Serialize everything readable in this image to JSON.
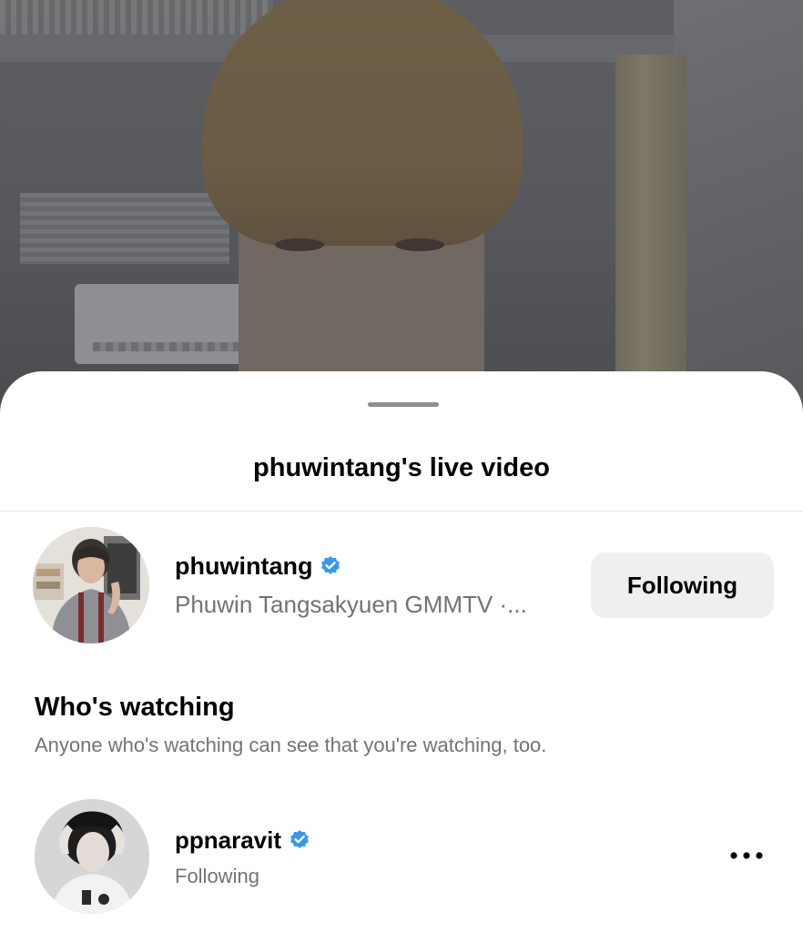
{
  "video": {
    "streamer": "phuwintang"
  },
  "sheet": {
    "title": "phuwintang's live video"
  },
  "host": {
    "username": "phuwintang",
    "subtitle": "Phuwin Tangsakyuen GMMTV ·...",
    "verified": true,
    "follow_button_label": "Following"
  },
  "watching": {
    "title": "Who's watching",
    "subtitle": "Anyone who's watching can see that you're watching, too.",
    "viewers": [
      {
        "username": "ppnaravit",
        "verified": true,
        "status": "Following"
      }
    ]
  },
  "colors": {
    "verified_badge": "#3897f0",
    "secondary_text": "#737373",
    "button_bg": "#efeff1"
  },
  "icons": {
    "verified": "verified-badge-icon",
    "more": "more-options-icon"
  }
}
